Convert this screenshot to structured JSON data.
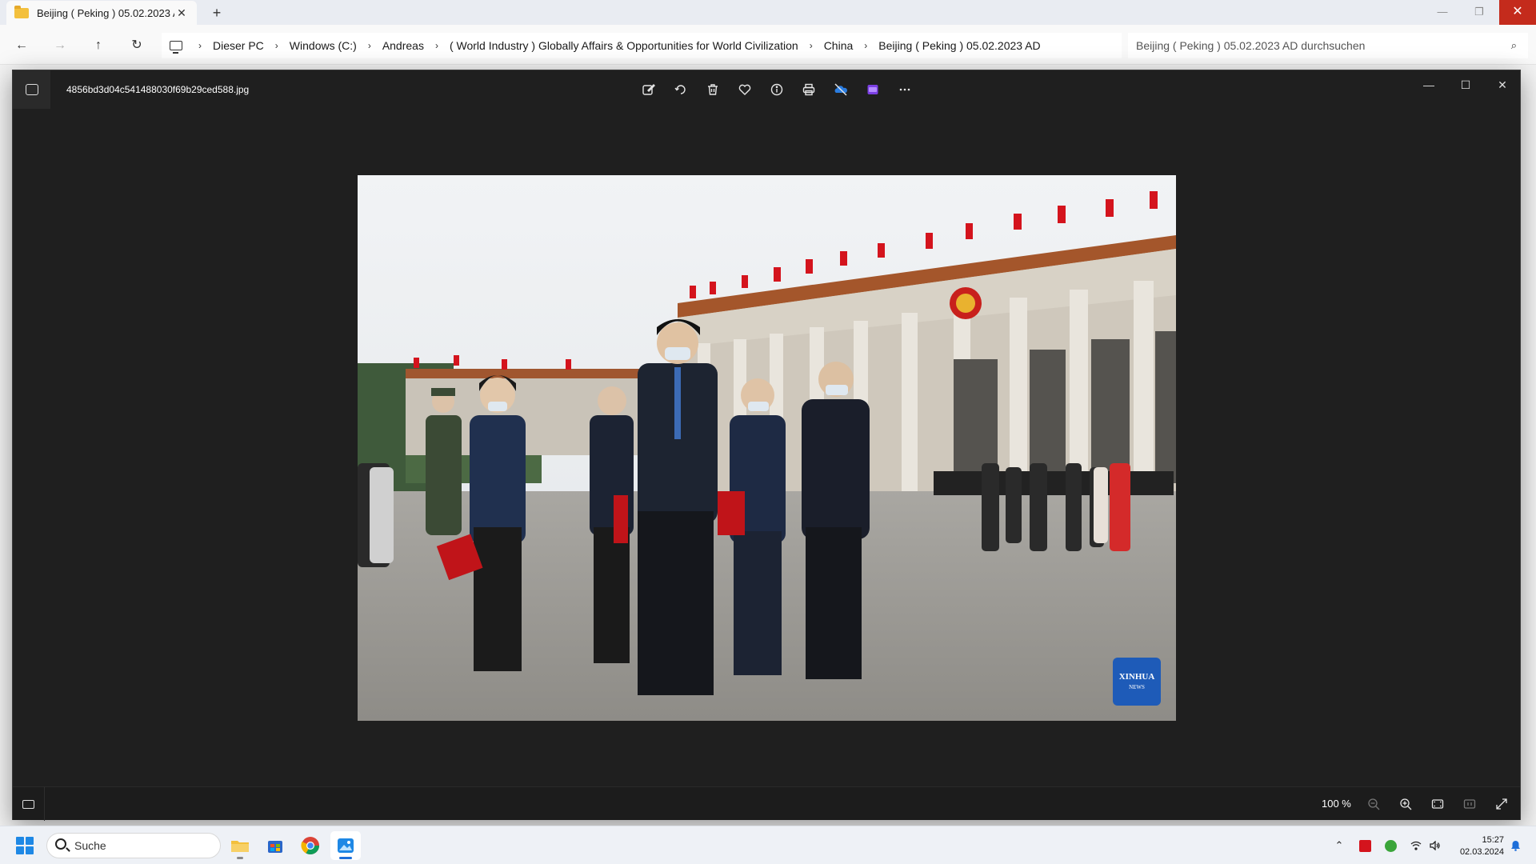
{
  "explorer": {
    "tab_title": "Beijing ( Peking ) 05.02.2023 A",
    "tab_close": "✕",
    "new_tab": "+",
    "window_controls": [
      "—",
      "❐",
      "✕"
    ],
    "breadcrumbs": [
      "Dieser PC",
      "Windows (C:)",
      "Andreas",
      "( World Industry ) Globally Affairs & Opportunities for World Civilization",
      "China",
      "Beijing ( Peking ) 05.02.2023 AD"
    ],
    "search_placeholder": "Beijing ( Peking ) 05.02.2023 AD durchsuchen"
  },
  "viewer": {
    "filename": "4856bd3d04c541488030f69b29ced588.jpg",
    "toolbar_icons": [
      "edit-icon",
      "rotate-icon",
      "delete-icon",
      "favorite-icon",
      "info-icon",
      "print-icon",
      "onedrive-icon",
      "clipchamp-icon",
      "more-icon"
    ],
    "window_controls": [
      "—",
      "☐",
      "✕"
    ],
    "zoom": "100 %",
    "watermark": {
      "line1": "XINHUA",
      "line2": "NEWS"
    }
  },
  "taskbar": {
    "search_label": "Suche",
    "time": "15:27",
    "date": "02.03.2024"
  },
  "colors": {
    "viewer_bg": "#1f1f1f",
    "close_red": "#c42b1c",
    "flag_red": "#d4141d",
    "accent_blue": "#1e6fd9"
  }
}
